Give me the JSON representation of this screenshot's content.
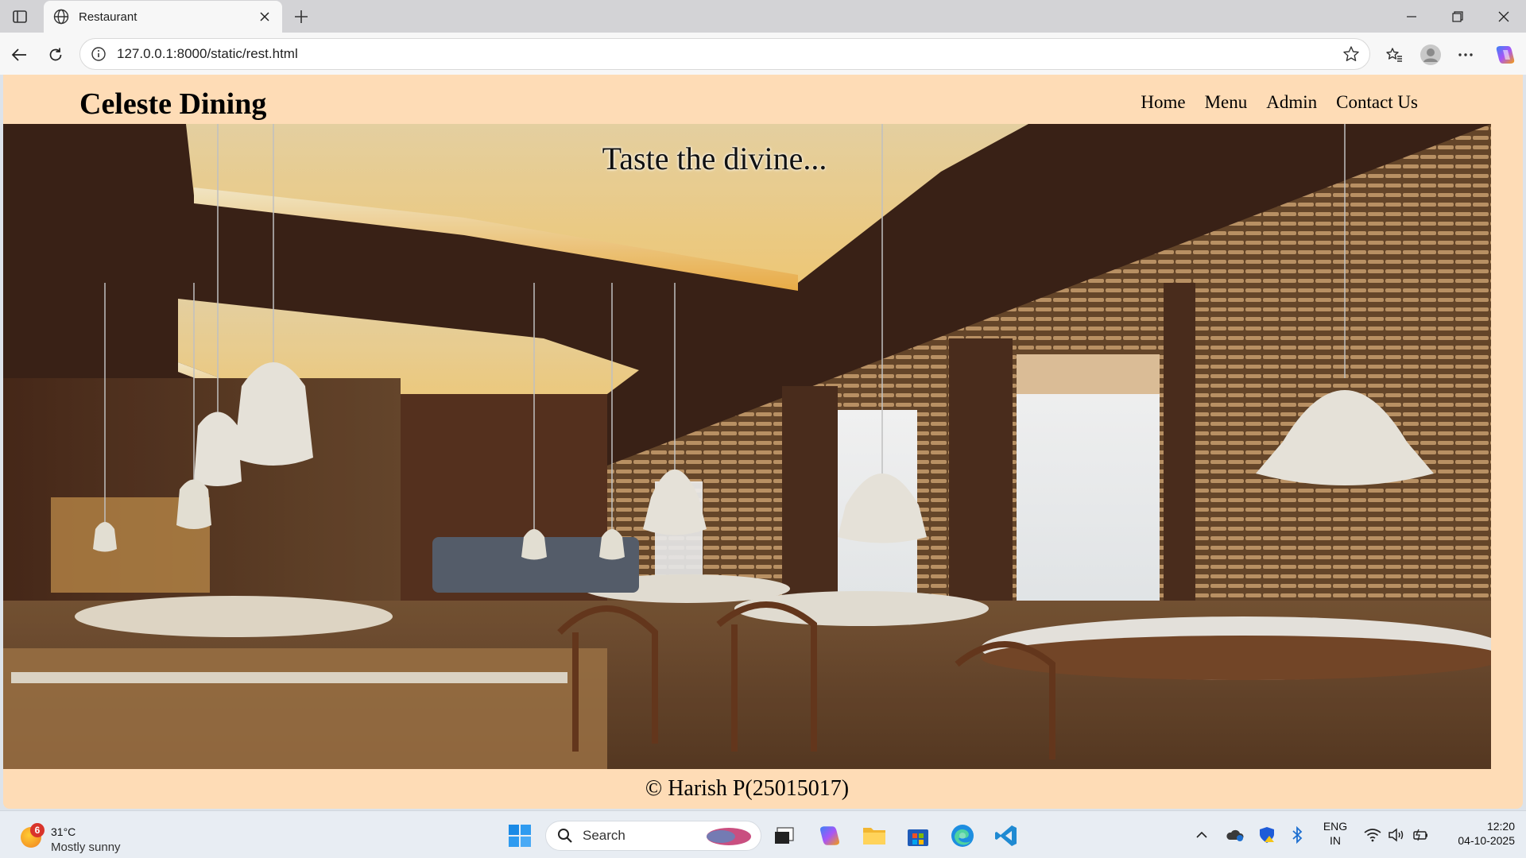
{
  "browser": {
    "tab_title": "Restaurant",
    "url": "127.0.0.1:8000/static/rest.html"
  },
  "site": {
    "brand": "Celeste Dining",
    "nav": [
      "Home",
      "Menu",
      "Admin",
      "Contact Us"
    ],
    "tagline": "Taste the divine...",
    "footer": "© Harish P(25015017)",
    "background_color": "#fedcb6"
  },
  "taskbar": {
    "weather_temp": "31°C",
    "weather_condition": "Mostly sunny",
    "weather_badge": "6",
    "search_label": "Search",
    "lang_line1": "ENG",
    "lang_line2": "IN",
    "time": "12:20",
    "date": "04-10-2025"
  }
}
